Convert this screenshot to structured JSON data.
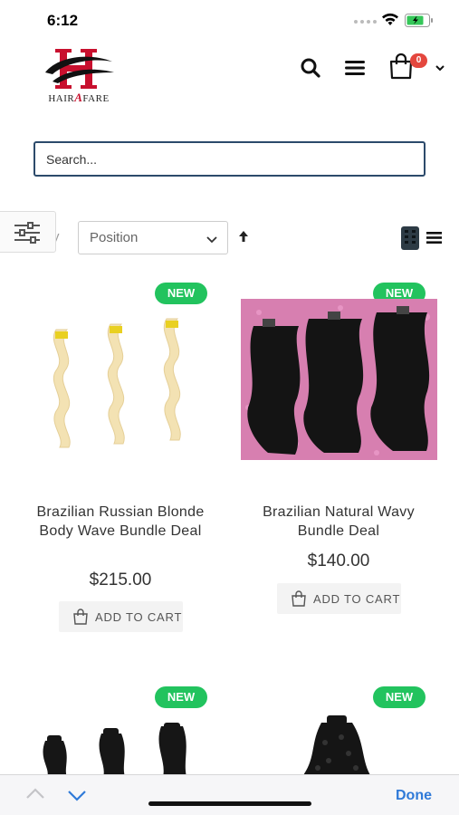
{
  "status_bar": {
    "time": "6:12"
  },
  "header": {
    "logo": {
      "initial": "H",
      "text_left": "HAIR",
      "text_mid": "A",
      "text_right": "FARE"
    },
    "cart_count": "0",
    "icons": [
      "search-icon",
      "menu-icon",
      "cart-icon",
      "chevron-down-icon"
    ]
  },
  "search": {
    "placeholder": "Search..."
  },
  "toolbar": {
    "sort_label": "Sort By",
    "sort_visible": "y",
    "sort_value": "Position"
  },
  "products": [
    {
      "badge": "NEW",
      "name": "Brazilian Russian Blonde Body Wave Bundle Deal",
      "price": "$215.00",
      "button": "ADD TO CART"
    },
    {
      "badge": "NEW",
      "name": "Brazilian Natural Wavy Bundle Deal",
      "price": "$140.00",
      "button": "ADD TO CART"
    },
    {
      "badge": "NEW"
    },
    {
      "badge": "NEW"
    }
  ],
  "keyboard_bar": {
    "done": "Done"
  },
  "colors": {
    "badge_green": "#22c35e",
    "cart_badge": "#e4473e",
    "accent_blue": "#2f7ad8",
    "logo_red": "#c8102e"
  }
}
